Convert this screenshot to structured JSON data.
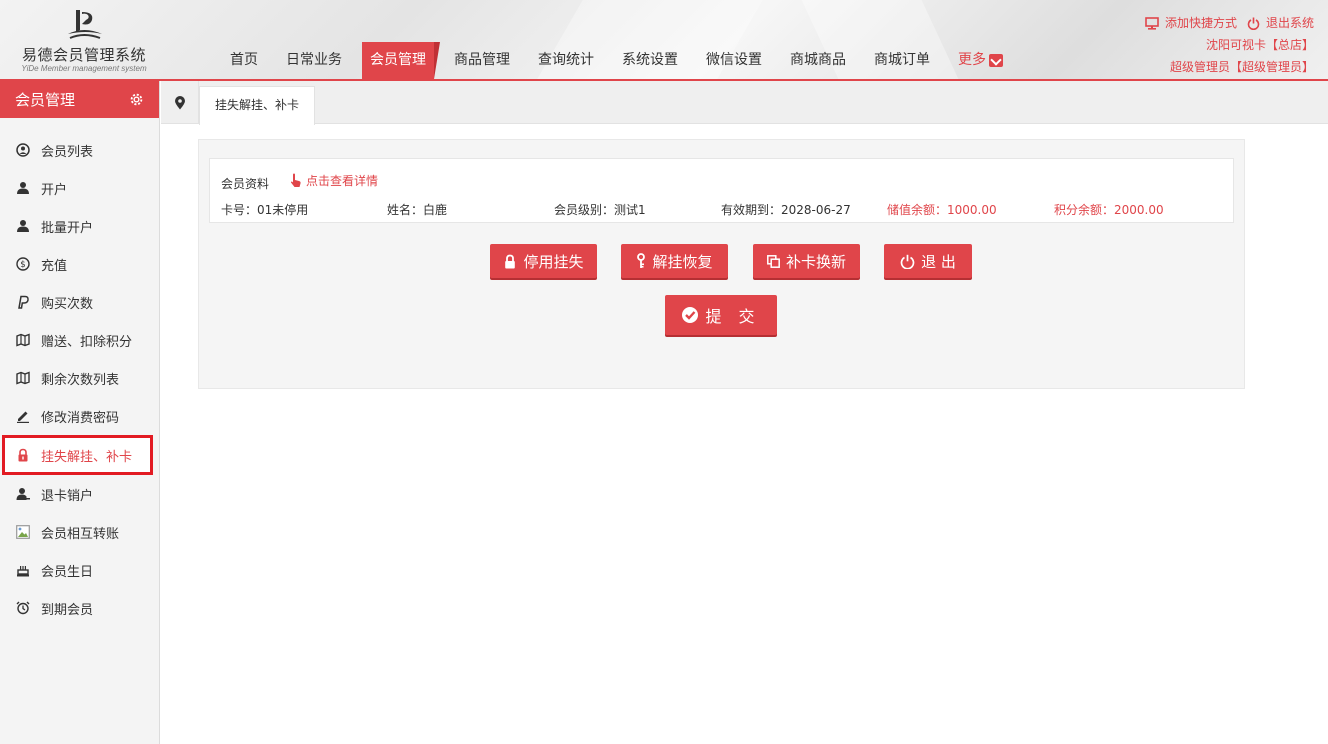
{
  "app": {
    "name": "易德会员管理系统",
    "name_en": "YiDe Member management system"
  },
  "nav": {
    "items": [
      "首页",
      "日常业务",
      "会员管理",
      "商品管理",
      "查询统计",
      "系统设置",
      "微信设置",
      "商城商品",
      "商城订单"
    ],
    "active": "会员管理",
    "more": "更多"
  },
  "top_right": {
    "add_shortcut": "添加快捷方式",
    "logout": "退出系统",
    "store": "沈阳可视卡【总店】",
    "user": "超级管理员【超级管理员】"
  },
  "sidebar": {
    "title": "会员管理",
    "items": [
      {
        "label": "会员列表",
        "icon": "user-circle-icon"
      },
      {
        "label": "开户",
        "icon": "user-icon"
      },
      {
        "label": "批量开户",
        "icon": "user-icon"
      },
      {
        "label": "充值",
        "icon": "dollar-circle-icon"
      },
      {
        "label": "购买次数",
        "icon": "paypal-icon"
      },
      {
        "label": "赠送、扣除积分",
        "icon": "map-icon"
      },
      {
        "label": "剩余次数列表",
        "icon": "map-icon"
      },
      {
        "label": "修改消费密码",
        "icon": "pencil-icon"
      },
      {
        "label": "挂失解挂、补卡",
        "icon": "lock-icon"
      },
      {
        "label": "退卡销户",
        "icon": "user-minus-icon"
      },
      {
        "label": "会员相互转账",
        "icon": "image-icon"
      },
      {
        "label": "会员生日",
        "icon": "cake-icon"
      },
      {
        "label": "到期会员",
        "icon": "alarm-clock-icon"
      }
    ],
    "active_index": 8
  },
  "tabs": {
    "items": [
      "挂失解挂、补卡"
    ]
  },
  "member": {
    "section_title": "会员资料",
    "detail_link": "点击查看详情",
    "card_no": "卡号：01未停用",
    "name": "姓名：白鹿",
    "level": "会员级别：测试1",
    "expiry": "有效期到：2028-06-27",
    "balance": "储值余额：1000.00",
    "points": "积分余额：2000.00"
  },
  "buttons": {
    "disable_loss": "停用挂失",
    "unlock_restore": "解挂恢复",
    "replace_card": "补卡换新",
    "exit": "退 出",
    "submit": "提 交"
  },
  "colors": {
    "accent": "#e0454a",
    "highlight_border": "#e21b23"
  }
}
